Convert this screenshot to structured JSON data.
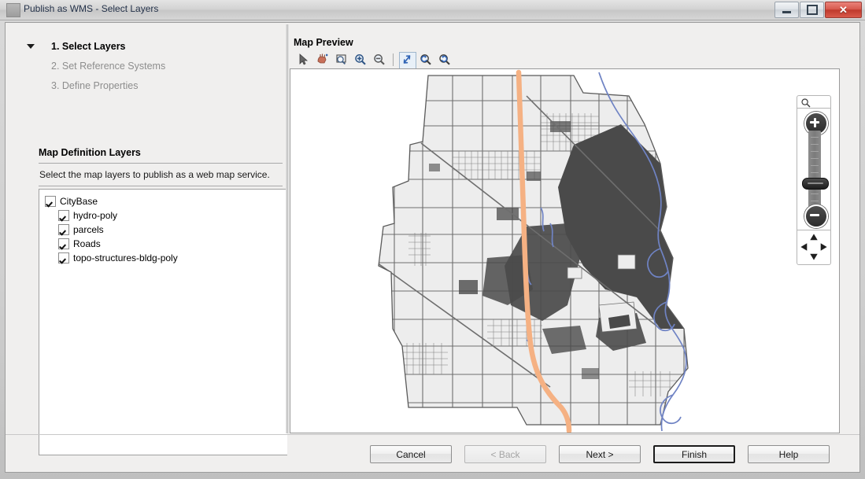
{
  "window": {
    "title": "Publish as WMS - Select Layers",
    "icon": "window-icon",
    "controls": {
      "minimize": "minimize-button",
      "maximize": "maximize-button",
      "close": "close-button",
      "close_glyph": "✕"
    }
  },
  "wizard": {
    "steps": [
      {
        "label": "1. Select Layers",
        "active": true
      },
      {
        "label": "2. Set Reference Systems",
        "active": false
      },
      {
        "label": "3. Define Properties",
        "active": false
      }
    ]
  },
  "layers_section": {
    "title": "Map Definition Layers",
    "description": "Select the map layers to publish as a web map service.",
    "tree": [
      {
        "label": "CityBase",
        "checked": true,
        "level": 0
      },
      {
        "label": "hydro-poly",
        "checked": true,
        "level": 1
      },
      {
        "label": "parcels",
        "checked": true,
        "level": 1
      },
      {
        "label": "Roads",
        "checked": true,
        "level": 1
      },
      {
        "label": "topo-structures-bldg-poly",
        "checked": true,
        "level": 1
      }
    ]
  },
  "map_preview": {
    "label": "Map Preview",
    "tools": [
      {
        "name": "select-arrow-tool",
        "title": "Select"
      },
      {
        "name": "pan-hand-tool",
        "title": "Pan"
      },
      {
        "name": "zoom-rectangle-tool",
        "title": "Zoom Rectangle"
      },
      {
        "name": "zoom-in-tool",
        "title": "Zoom In"
      },
      {
        "name": "zoom-out-tool",
        "title": "Zoom Out"
      },
      {
        "name": "zoom-extent-tool",
        "title": "Zoom to Extent"
      },
      {
        "name": "zoom-previous-tool",
        "title": "Previous Extent"
      },
      {
        "name": "zoom-next-tool",
        "title": "Next Extent"
      }
    ],
    "navigation": {
      "search_icon": "search-icon",
      "zoom_in_glyph": "+",
      "zoom_out_glyph": "−",
      "pan_directions": [
        "north",
        "east",
        "south",
        "west"
      ]
    },
    "colors": {
      "parcel_fill": "#ededed",
      "parcel_stroke": "#6e6e6e",
      "building_fill": "#4a4a4a",
      "road_highway": "#f5b183",
      "hydro_line": "#6f83c4",
      "background": "#ffffff"
    }
  },
  "footer": {
    "buttons": [
      {
        "label": "Cancel",
        "state": "enabled",
        "name": "cancel-button"
      },
      {
        "label": "< Back",
        "state": "disabled",
        "name": "back-button"
      },
      {
        "label": "Next >",
        "state": "enabled",
        "name": "next-button"
      },
      {
        "label": "Finish",
        "state": "default",
        "name": "finish-button"
      },
      {
        "label": "Help",
        "state": "enabled",
        "name": "help-button"
      }
    ]
  }
}
